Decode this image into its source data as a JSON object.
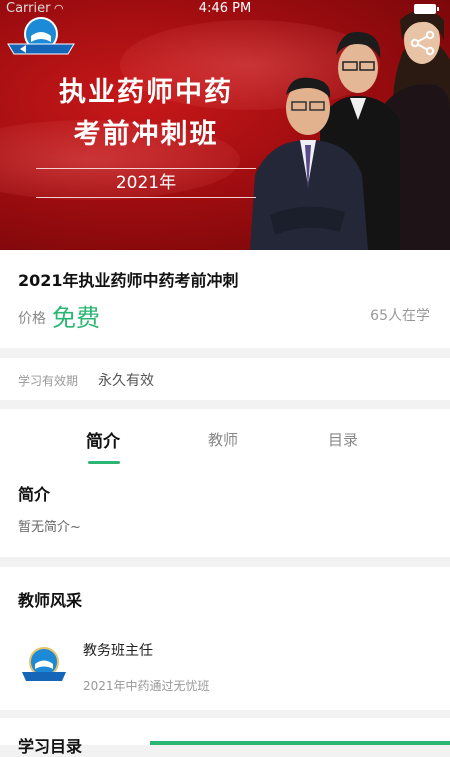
{
  "status_bar": {
    "carrier": "Carrier",
    "time": "4:46 PM"
  },
  "banner": {
    "title_line1": "执业药师中药",
    "title_line2": "考前冲刺班",
    "year": "2021年"
  },
  "course": {
    "title": "2021年执业药师中药考前冲刺",
    "price_label": "价格",
    "price_value": "免费",
    "learners": "65人在学"
  },
  "validity": {
    "label": "学习有效期",
    "value": "永久有效"
  },
  "tabs": [
    {
      "label": "简介",
      "active": true
    },
    {
      "label": "教师",
      "active": false
    },
    {
      "label": "目录",
      "active": false
    }
  ],
  "intro": {
    "heading": "简介",
    "text": "暂无简介~"
  },
  "teachers": {
    "heading": "教师风采",
    "items": [
      {
        "name": "教务班主任",
        "description": "2021年中药通过无忧班"
      }
    ]
  },
  "next_section": {
    "heading": "学习目录"
  },
  "colors": {
    "accent": "#2bb673",
    "banner_red": "#a00d10"
  },
  "icons": {
    "back": "chevron-left-icon",
    "share": "share-icon",
    "logo": "school-logo-icon"
  }
}
